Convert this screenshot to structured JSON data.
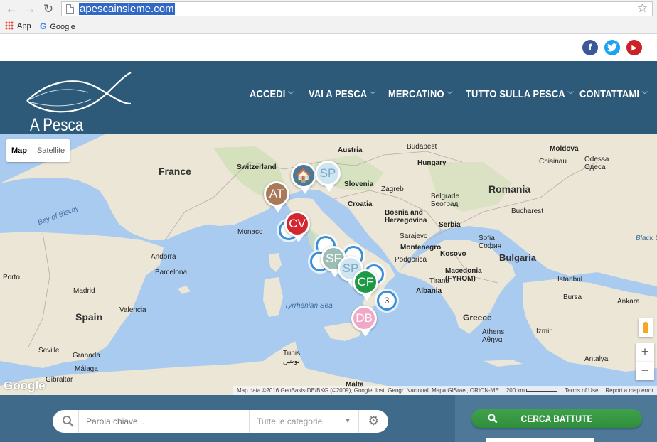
{
  "browser": {
    "url": "apescainsieme.com",
    "bookmarks": [
      {
        "label": "App",
        "icon": "apps-grid-icon"
      },
      {
        "label": "Google",
        "icon": "google-icon"
      }
    ]
  },
  "social": {
    "items": [
      {
        "name": "facebook-icon",
        "glyph": "f",
        "color": "#3b5998"
      },
      {
        "name": "twitter-icon",
        "glyph": "t",
        "color": "#1da1f2"
      },
      {
        "name": "youtube-icon",
        "glyph": "▶",
        "color": "#cc2127"
      }
    ]
  },
  "header": {
    "site_name": "A Pesca Insieme",
    "menu": [
      "ACCEDI",
      "VAI A PESCA",
      "MERCATINO",
      "TUTTO SULLA PESCA",
      "CONTATTAMI"
    ]
  },
  "map": {
    "type_map": "Map",
    "type_satellite": "Satellite",
    "countries": [
      "France",
      "Switzerland",
      "Austria",
      "Hungary",
      "Slovenia",
      "Croatia",
      "Romania",
      "Moldova",
      "Bosnia and Herzegovina",
      "Serbia",
      "Montenegro",
      "Kosovo",
      "Bulgaria",
      "Macedonia (FYROM)",
      "Albania",
      "Greece",
      "Spain",
      "Malta"
    ],
    "cities": [
      "Budapest",
      "Chisinau",
      "Odessa Одеса",
      "Zagreb",
      "Belgrade Београд",
      "Bucharest",
      "Sarajevo",
      "Monaco",
      "Podgorica",
      "Sofia София",
      "Andorra",
      "Barcelona",
      "Tirana",
      "Porto",
      "Madrid",
      "Valencia",
      "Istanbul",
      "Bursa",
      "Ankara",
      "Athens Αθήνα",
      "Izmir",
      "Antalya",
      "Seville",
      "Granada",
      "Málaga",
      "Gibraltar",
      "Tunis تونس"
    ],
    "seas": [
      "Bay of Biscay",
      "Tyrrhenian Sea",
      "Black S"
    ],
    "markers": [
      {
        "label": "AT",
        "color": "#a87a5a"
      },
      {
        "label": "SP",
        "color": "#cfe6f2"
      },
      {
        "label": "CV",
        "color": "#d3262e"
      },
      {
        "label": "SF",
        "color": "#9dbfb3"
      },
      {
        "label": "SP",
        "color": "#cfe6f2"
      },
      {
        "label": "CF",
        "color": "#1e9a46"
      },
      {
        "label": "DB",
        "color": "#f0a8c6"
      }
    ],
    "cluster_count": "3",
    "zoom_in": "+",
    "zoom_out": "−",
    "logo": "Google",
    "attribution": "Map data ©2016 GeoBasis-DE/BKG (©2009), Google, Inst. Geogr. Nacional, Mapa GISrael, ORION-ME",
    "scale": "200 km",
    "terms": "Terms of Use",
    "report": "Report a map error"
  },
  "search": {
    "placeholder": "Parola chiave...",
    "category": "Tutte le categorie",
    "button": "CERCA BATTUTE"
  }
}
